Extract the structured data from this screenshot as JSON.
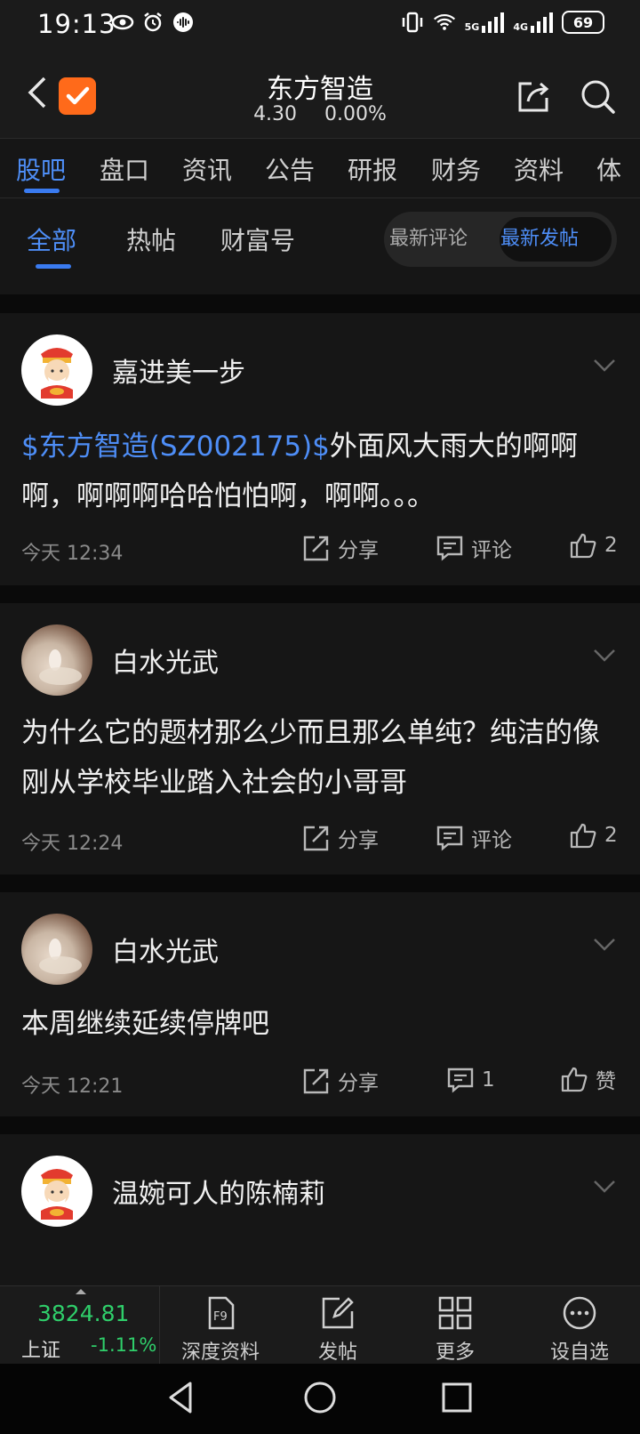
{
  "status_bar": {
    "time": "19:13",
    "network_5g": "5G",
    "network_4g": "4G",
    "battery": "69",
    "icons_left": [
      "eye-icon",
      "alarm-icon",
      "voice-icon"
    ],
    "icons_right": [
      "vibrate-icon",
      "wifi-icon",
      "signal-icon",
      "signal-icon"
    ]
  },
  "header": {
    "title": "东方智造",
    "price": "4.30",
    "change_pct": "0.00%",
    "logo_color": "#ff6a1a"
  },
  "tabs": [
    {
      "label": "股吧",
      "active": true
    },
    {
      "label": "盘口"
    },
    {
      "label": "资讯"
    },
    {
      "label": "公告"
    },
    {
      "label": "研报"
    },
    {
      "label": "财务"
    },
    {
      "label": "资料"
    },
    {
      "label": "体"
    }
  ],
  "subtabs": [
    {
      "label": "全部",
      "active": true
    },
    {
      "label": "热帖"
    },
    {
      "label": "财富号"
    }
  ],
  "sort_toggle": {
    "options": [
      {
        "label": "最新评论"
      },
      {
        "label": "最新发帖",
        "active": true
      }
    ]
  },
  "posts": [
    {
      "user": "嘉进美一步",
      "avatar": "caishen-avatar",
      "tag": "$东方智造(SZ002175)$",
      "content": "外面风大雨大的啊啊啊，啊啊啊哈哈怕怕啊，啊啊。。。",
      "time": "今天 12:34",
      "share_label": "分享",
      "comment_label": "评论",
      "like_label": "2"
    },
    {
      "user": "白水光武",
      "avatar": "photo-avatar",
      "tag": "",
      "content": "为什么它的题材那么少而且那么单纯？纯洁的像刚从学校毕业踏入社会的小哥哥",
      "time": "今天 12:24",
      "share_label": "分享",
      "comment_label": "评论",
      "like_label": "2"
    },
    {
      "user": "白水光武",
      "avatar": "photo-avatar",
      "tag": "",
      "content": "本周继续延续停牌吧",
      "time": "今天 12:21",
      "share_label": "分享",
      "comment_label": "1",
      "like_label": "赞"
    },
    {
      "user": "温婉可人的陈楠莉",
      "avatar": "caishen-avatar"
    }
  ],
  "bottom_bar": {
    "index_value": "3824.81",
    "index_name": "上证",
    "index_change": "-1.11%",
    "items": [
      {
        "label": "深度资料",
        "icon": "f9-icon"
      },
      {
        "label": "发帖",
        "icon": "edit-icon"
      },
      {
        "label": "更多",
        "icon": "grid-icon"
      },
      {
        "label": "设自选",
        "icon": "more-circle-icon"
      }
    ]
  },
  "colors": {
    "accent": "#4e8ef7",
    "down": "#2fce6a",
    "background": "#111111"
  }
}
